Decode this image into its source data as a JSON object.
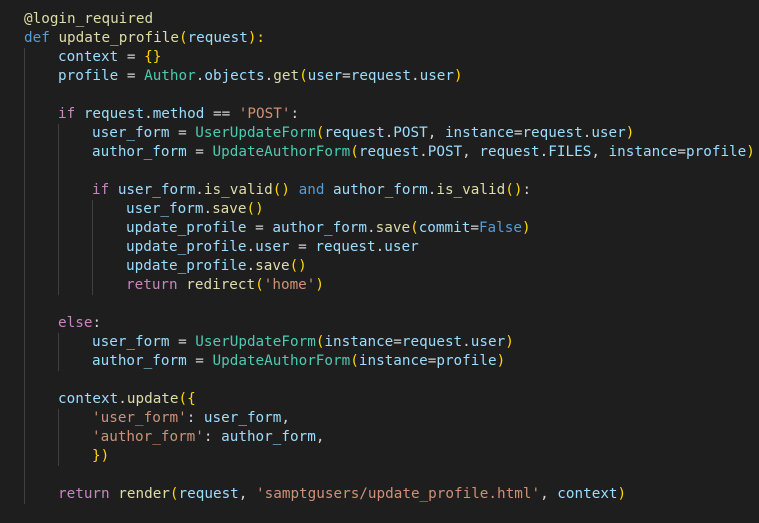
{
  "editor": {
    "theme": "dark",
    "colors": {
      "background": "#1e1e1e",
      "plain": "#d4d4d4",
      "variable": "#9cdcfe",
      "keyword": "#569cd6",
      "control": "#c586c0",
      "function": "#dcdcaa",
      "class": "#4ec9b0",
      "string": "#ce9178",
      "bracket": "#ffd700",
      "indent_guide": "#404040"
    },
    "lines": [
      {
        "indent": 0,
        "tokens": [
          [
            "@login_required",
            "deco"
          ]
        ]
      },
      {
        "indent": 0,
        "tokens": [
          [
            "def",
            "kw"
          ],
          [
            " ",
            "plain"
          ],
          [
            "update_profile",
            "func"
          ],
          [
            "(",
            "bracket"
          ],
          [
            "request",
            "var"
          ],
          [
            "):",
            "bracket"
          ]
        ]
      },
      {
        "indent": 1,
        "tokens": [
          [
            "context",
            "var"
          ],
          [
            " = ",
            "plain"
          ],
          [
            "{}",
            "bracket"
          ]
        ]
      },
      {
        "indent": 1,
        "tokens": [
          [
            "profile",
            "var"
          ],
          [
            " = ",
            "plain"
          ],
          [
            "Author",
            "class"
          ],
          [
            ".",
            "plain"
          ],
          [
            "objects",
            "var"
          ],
          [
            ".",
            "plain"
          ],
          [
            "get",
            "func"
          ],
          [
            "(",
            "bracket"
          ],
          [
            "user",
            "var"
          ],
          [
            "=",
            "plain"
          ],
          [
            "request",
            "var"
          ],
          [
            ".",
            "plain"
          ],
          [
            "user",
            "var"
          ],
          [
            ")",
            "bracket"
          ]
        ]
      },
      {
        "indent": 1,
        "tokens": []
      },
      {
        "indent": 1,
        "tokens": [
          [
            "if",
            "ctrl"
          ],
          [
            " ",
            "plain"
          ],
          [
            "request",
            "var"
          ],
          [
            ".",
            "plain"
          ],
          [
            "method",
            "var"
          ],
          [
            " == ",
            "plain"
          ],
          [
            "'POST'",
            "str"
          ],
          [
            ":",
            "plain"
          ]
        ]
      },
      {
        "indent": 2,
        "tokens": [
          [
            "user_form",
            "var"
          ],
          [
            " = ",
            "plain"
          ],
          [
            "UserUpdateForm",
            "class"
          ],
          [
            "(",
            "bracket"
          ],
          [
            "request",
            "var"
          ],
          [
            ".",
            "plain"
          ],
          [
            "POST",
            "var"
          ],
          [
            ", ",
            "plain"
          ],
          [
            "instance",
            "var"
          ],
          [
            "=",
            "plain"
          ],
          [
            "request",
            "var"
          ],
          [
            ".",
            "plain"
          ],
          [
            "user",
            "var"
          ],
          [
            ")",
            "bracket"
          ]
        ]
      },
      {
        "indent": 2,
        "tokens": [
          [
            "author_form",
            "var"
          ],
          [
            " = ",
            "plain"
          ],
          [
            "UpdateAuthorForm",
            "class"
          ],
          [
            "(",
            "bracket"
          ],
          [
            "request",
            "var"
          ],
          [
            ".",
            "plain"
          ],
          [
            "POST",
            "var"
          ],
          [
            ", ",
            "plain"
          ],
          [
            "request",
            "var"
          ],
          [
            ".",
            "plain"
          ],
          [
            "FILES",
            "var"
          ],
          [
            ", ",
            "plain"
          ],
          [
            "instance",
            "var"
          ],
          [
            "=",
            "plain"
          ],
          [
            "profile",
            "var"
          ],
          [
            ")",
            "bracket"
          ]
        ]
      },
      {
        "indent": 2,
        "tokens": []
      },
      {
        "indent": 2,
        "tokens": [
          [
            "if",
            "ctrl"
          ],
          [
            " ",
            "plain"
          ],
          [
            "user_form",
            "var"
          ],
          [
            ".",
            "plain"
          ],
          [
            "is_valid",
            "func"
          ],
          [
            "()",
            "bracket"
          ],
          [
            " ",
            "plain"
          ],
          [
            "and",
            "kw"
          ],
          [
            " ",
            "plain"
          ],
          [
            "author_form",
            "var"
          ],
          [
            ".",
            "plain"
          ],
          [
            "is_valid",
            "func"
          ],
          [
            "()",
            "bracket"
          ],
          [
            ":",
            "plain"
          ]
        ]
      },
      {
        "indent": 3,
        "tokens": [
          [
            "user_form",
            "var"
          ],
          [
            ".",
            "plain"
          ],
          [
            "save",
            "func"
          ],
          [
            "()",
            "bracket"
          ]
        ]
      },
      {
        "indent": 3,
        "tokens": [
          [
            "update_profile",
            "var"
          ],
          [
            " = ",
            "plain"
          ],
          [
            "author_form",
            "var"
          ],
          [
            ".",
            "plain"
          ],
          [
            "save",
            "func"
          ],
          [
            "(",
            "bracket"
          ],
          [
            "commit",
            "var"
          ],
          [
            "=",
            "plain"
          ],
          [
            "False",
            "kw"
          ],
          [
            ")",
            "bracket"
          ]
        ]
      },
      {
        "indent": 3,
        "tokens": [
          [
            "update_profile",
            "var"
          ],
          [
            ".",
            "plain"
          ],
          [
            "user",
            "var"
          ],
          [
            " = ",
            "plain"
          ],
          [
            "request",
            "var"
          ],
          [
            ".",
            "plain"
          ],
          [
            "user",
            "var"
          ]
        ]
      },
      {
        "indent": 3,
        "tokens": [
          [
            "update_profile",
            "var"
          ],
          [
            ".",
            "plain"
          ],
          [
            "save",
            "func"
          ],
          [
            "()",
            "bracket"
          ]
        ]
      },
      {
        "indent": 3,
        "tokens": [
          [
            "return",
            "ctrl"
          ],
          [
            " ",
            "plain"
          ],
          [
            "redirect",
            "func"
          ],
          [
            "(",
            "bracket"
          ],
          [
            "'home'",
            "str"
          ],
          [
            ")",
            "bracket"
          ]
        ]
      },
      {
        "indent": 1,
        "tokens": []
      },
      {
        "indent": 1,
        "tokens": [
          [
            "else",
            "ctrl"
          ],
          [
            ":",
            "plain"
          ]
        ]
      },
      {
        "indent": 2,
        "tokens": [
          [
            "user_form",
            "var"
          ],
          [
            " = ",
            "plain"
          ],
          [
            "UserUpdateForm",
            "class"
          ],
          [
            "(",
            "bracket"
          ],
          [
            "instance",
            "var"
          ],
          [
            "=",
            "plain"
          ],
          [
            "request",
            "var"
          ],
          [
            ".",
            "plain"
          ],
          [
            "user",
            "var"
          ],
          [
            ")",
            "bracket"
          ]
        ]
      },
      {
        "indent": 2,
        "tokens": [
          [
            "author_form",
            "var"
          ],
          [
            " = ",
            "plain"
          ],
          [
            "UpdateAuthorForm",
            "class"
          ],
          [
            "(",
            "bracket"
          ],
          [
            "instance",
            "var"
          ],
          [
            "=",
            "plain"
          ],
          [
            "profile",
            "var"
          ],
          [
            ")",
            "bracket"
          ]
        ]
      },
      {
        "indent": 1,
        "tokens": []
      },
      {
        "indent": 1,
        "tokens": [
          [
            "context",
            "var"
          ],
          [
            ".",
            "plain"
          ],
          [
            "update",
            "func"
          ],
          [
            "({",
            "bracket"
          ]
        ]
      },
      {
        "indent": 2,
        "tokens": [
          [
            "'user_form'",
            "str"
          ],
          [
            ": ",
            "plain"
          ],
          [
            "user_form",
            "var"
          ],
          [
            ",",
            "plain"
          ]
        ]
      },
      {
        "indent": 2,
        "tokens": [
          [
            "'author_form'",
            "str"
          ],
          [
            ": ",
            "plain"
          ],
          [
            "author_form",
            "var"
          ],
          [
            ",",
            "plain"
          ]
        ]
      },
      {
        "indent": 2,
        "tokens": [
          [
            "})",
            "bracket"
          ]
        ]
      },
      {
        "indent": 1,
        "tokens": []
      },
      {
        "indent": 1,
        "tokens": [
          [
            "return",
            "ctrl"
          ],
          [
            " ",
            "plain"
          ],
          [
            "render",
            "func"
          ],
          [
            "(",
            "bracket"
          ],
          [
            "request",
            "var"
          ],
          [
            ", ",
            "plain"
          ],
          [
            "'samptgusers/update_profile.html'",
            "str"
          ],
          [
            ", ",
            "plain"
          ],
          [
            "context",
            "var"
          ],
          [
            ")",
            "bracket"
          ]
        ]
      }
    ]
  }
}
